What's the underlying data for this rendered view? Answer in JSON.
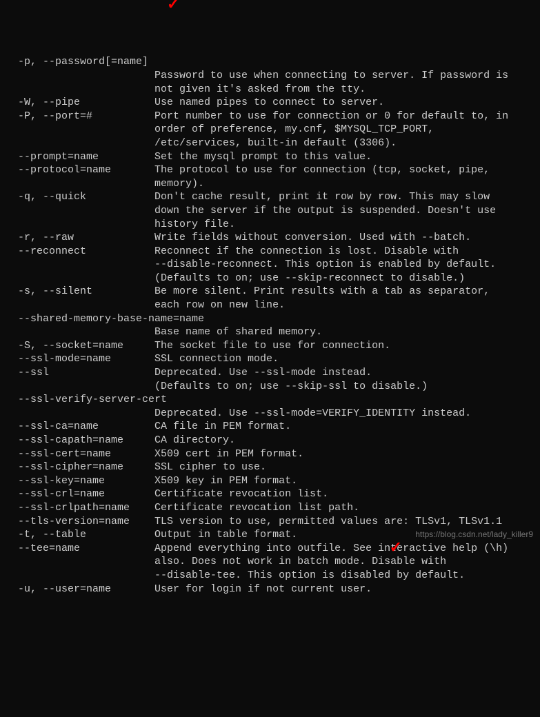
{
  "rows": [
    {
      "opt": "-p, --password[=name]",
      "desc": ""
    },
    {
      "opt": "",
      "desc": "Password to use when connecting to server. If password is"
    },
    {
      "opt": "",
      "desc": "not given it's asked from the tty."
    },
    {
      "opt": "-W, --pipe",
      "desc": "Use named pipes to connect to server."
    },
    {
      "opt": "-P, --port=#",
      "desc": "Port number to use for connection or 0 for default to, in"
    },
    {
      "opt": "",
      "desc": "order of preference, my.cnf, $MYSQL_TCP_PORT,"
    },
    {
      "opt": "",
      "desc": "/etc/services, built-in default (3306)."
    },
    {
      "opt": "--prompt=name",
      "desc": "Set the mysql prompt to this value."
    },
    {
      "opt": "--protocol=name",
      "desc": "The protocol to use for connection (tcp, socket, pipe,"
    },
    {
      "opt": "",
      "desc": "memory)."
    },
    {
      "opt": "-q, --quick",
      "desc": "Don't cache result, print it row by row. This may slow"
    },
    {
      "opt": "",
      "desc": "down the server if the output is suspended. Doesn't use"
    },
    {
      "opt": "",
      "desc": "history file."
    },
    {
      "opt": "-r, --raw",
      "desc": "Write fields without conversion. Used with --batch."
    },
    {
      "opt": "--reconnect",
      "desc": "Reconnect if the connection is lost. Disable with"
    },
    {
      "opt": "",
      "desc": "--disable-reconnect. This option is enabled by default."
    },
    {
      "opt": "",
      "desc": "(Defaults to on; use --skip-reconnect to disable.)"
    },
    {
      "opt": "-s, --silent",
      "desc": "Be more silent. Print results with a tab as separator,"
    },
    {
      "opt": "",
      "desc": "each row on new line."
    },
    {
      "opt": "--shared-memory-base-name=name",
      "desc": ""
    },
    {
      "opt": "",
      "desc": "Base name of shared memory."
    },
    {
      "opt": "-S, --socket=name",
      "desc": "The socket file to use for connection."
    },
    {
      "opt": "--ssl-mode=name",
      "desc": "SSL connection mode."
    },
    {
      "opt": "--ssl",
      "desc": "Deprecated. Use --ssl-mode instead."
    },
    {
      "opt": "",
      "desc": "(Defaults to on; use --skip-ssl to disable.)"
    },
    {
      "opt": "--ssl-verify-server-cert",
      "desc": ""
    },
    {
      "opt": "",
      "desc": "Deprecated. Use --ssl-mode=VERIFY_IDENTITY instead."
    },
    {
      "opt": "--ssl-ca=name",
      "desc": "CA file in PEM format."
    },
    {
      "opt": "--ssl-capath=name",
      "desc": "CA directory."
    },
    {
      "opt": "--ssl-cert=name",
      "desc": "X509 cert in PEM format."
    },
    {
      "opt": "--ssl-cipher=name",
      "desc": "SSL cipher to use."
    },
    {
      "opt": "--ssl-key=name",
      "desc": "X509 key in PEM format."
    },
    {
      "opt": "--ssl-crl=name",
      "desc": "Certificate revocation list."
    },
    {
      "opt": "--ssl-crlpath=name",
      "desc": "Certificate revocation list path."
    },
    {
      "opt": "--tls-version=name",
      "desc": "TLS version to use, permitted values are: TLSv1, TLSv1.1"
    },
    {
      "opt": "-t, --table",
      "desc": "Output in table format."
    },
    {
      "opt": "--tee=name",
      "desc": "Append everything into outfile. See interactive help (\\h)"
    },
    {
      "opt": "",
      "desc": "also. Does not work in batch mode. Disable with"
    },
    {
      "opt": "",
      "desc": "--disable-tee. This option is disabled by default."
    },
    {
      "opt": "-u, --user=name",
      "desc": "User for login if not current user."
    }
  ],
  "annotations": {
    "checkmark": "✓",
    "watermark": "https://blog.csdn.net/lady_killer9"
  },
  "layout": {
    "indent": "  ",
    "optCol": 22
  }
}
